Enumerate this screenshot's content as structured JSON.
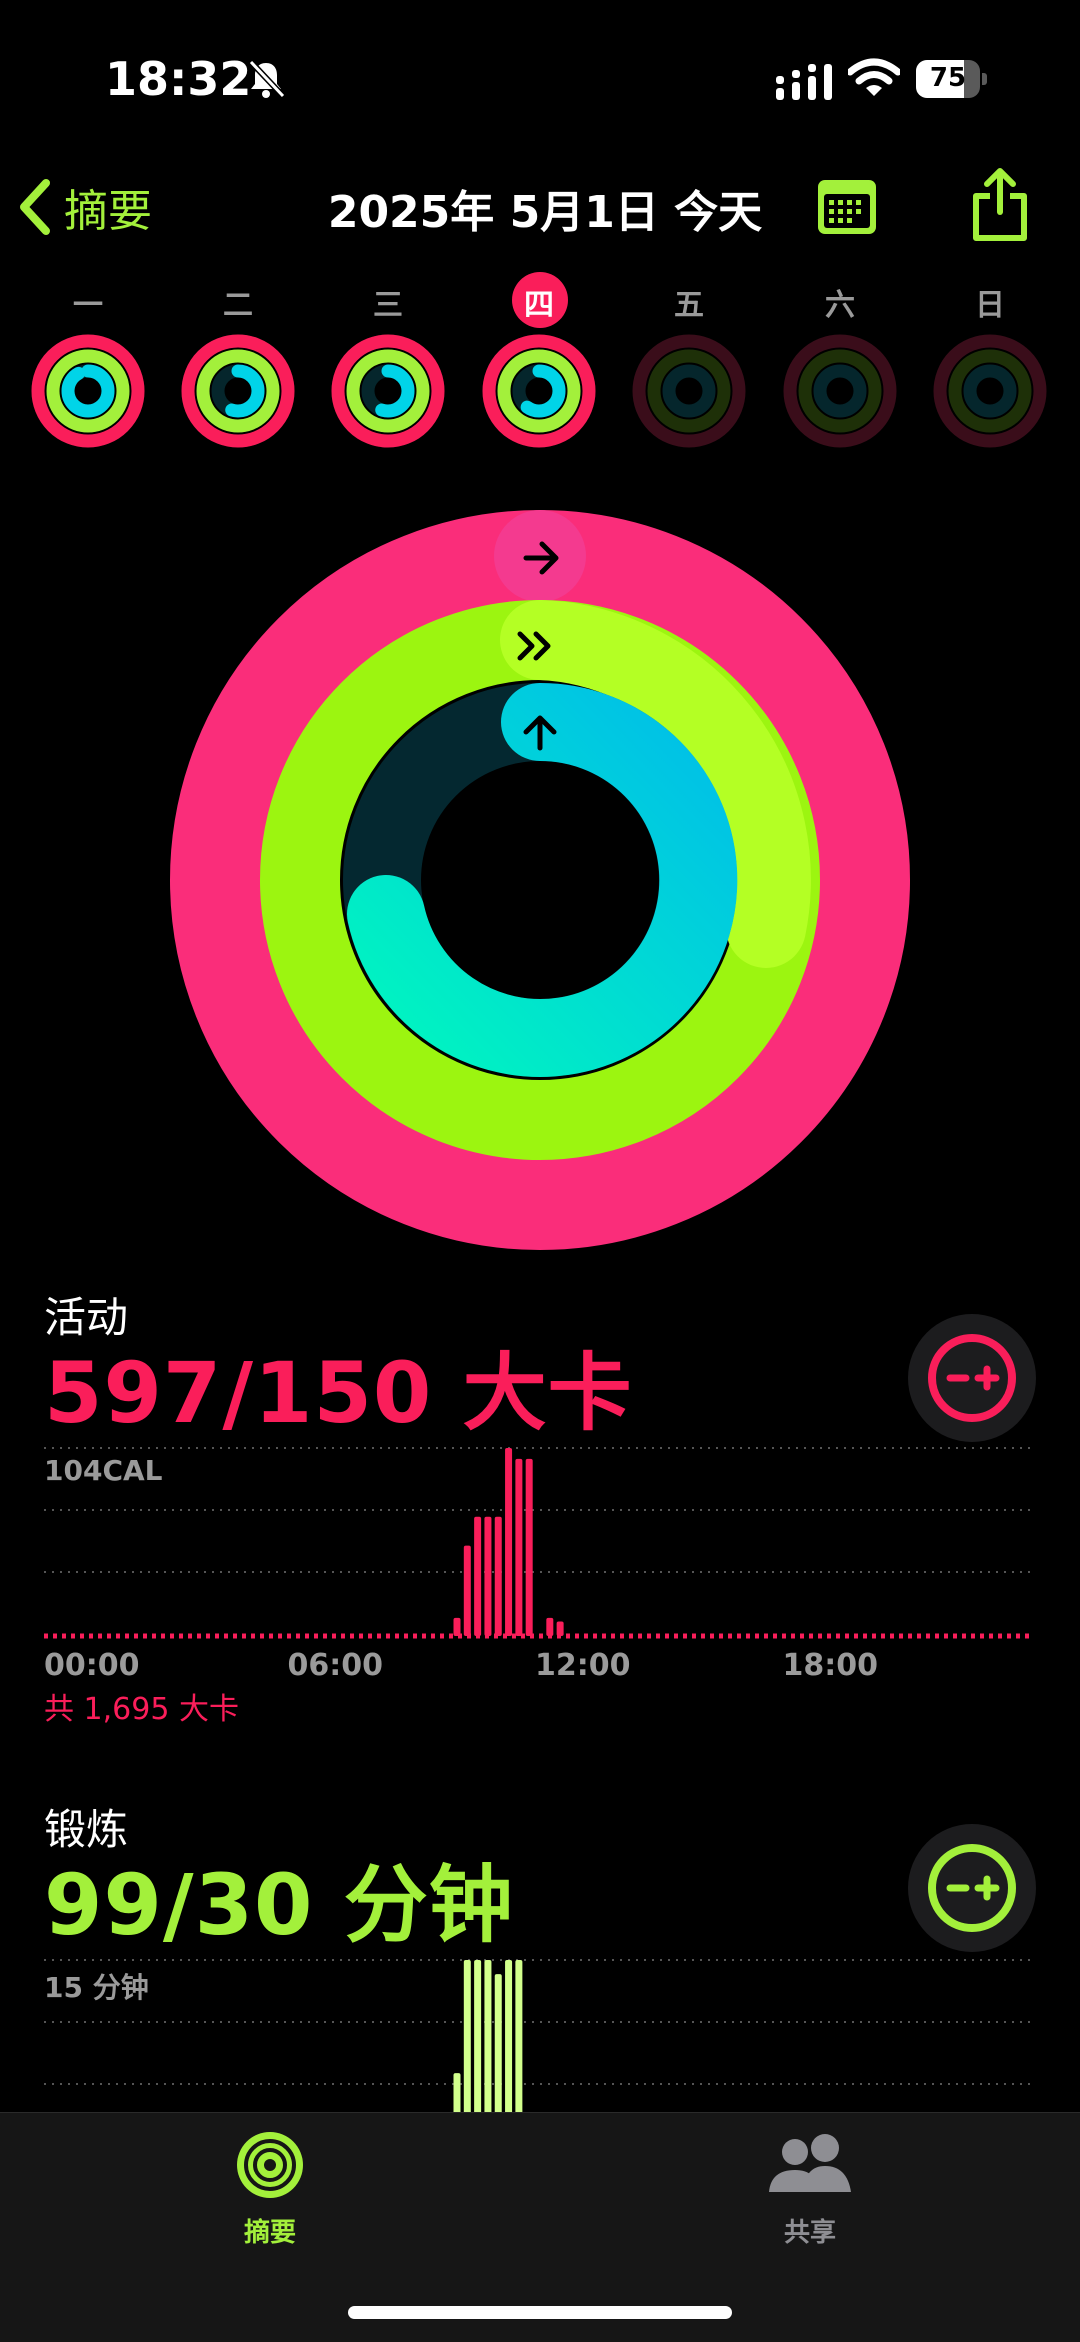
{
  "status": {
    "time": "18:32",
    "battery": "75",
    "battery_level": 0.75
  },
  "nav": {
    "back_label": "摘要",
    "title": "2025年 5月1日 今天"
  },
  "week": [
    {
      "label": "一",
      "move": 1.0,
      "exercise": 1.0,
      "stand": 0.92,
      "active": true
    },
    {
      "label": "二",
      "move": 1.0,
      "exercise": 1.0,
      "stand": 0.55,
      "active": true
    },
    {
      "label": "三",
      "move": 1.0,
      "exercise": 1.0,
      "stand": 0.55,
      "active": true
    },
    {
      "label": "四",
      "move": 1.0,
      "exercise": 1.0,
      "stand": 0.6,
      "active": true,
      "today": true
    },
    {
      "label": "五",
      "move": 0,
      "exercise": 0,
      "stand": 0,
      "active": false
    },
    {
      "label": "六",
      "move": 0,
      "exercise": 0,
      "stand": 0,
      "active": false
    },
    {
      "label": "日",
      "move": 0,
      "exercise": 0,
      "stand": 0,
      "active": false
    }
  ],
  "colors": {
    "move": "#fa1e5a",
    "exercise": "#a3f03b",
    "stand": "#00d4e8",
    "accent": "#a3f03b"
  },
  "activity": {
    "title": "活动",
    "value": "597/150 大卡",
    "chart_max_label": "104CAL",
    "total": "共 1,695 大卡"
  },
  "exercise": {
    "title": "锻炼",
    "value": "99/30 分钟",
    "chart_max_label": "15 分钟"
  },
  "chart_data": [
    {
      "type": "bar",
      "x_ticks": [
        "00:00",
        "06:00",
        "12:00",
        "18:00"
      ],
      "ylabel": "104CAL",
      "ylim": [
        0,
        104
      ],
      "x": [
        "10:00",
        "10:15",
        "10:30",
        "10:45",
        "11:00",
        "11:15",
        "11:30",
        "11:45",
        "12:15",
        "12:30"
      ],
      "values": [
        10,
        50,
        66,
        66,
        66,
        104,
        98,
        98,
        10,
        8
      ]
    },
    {
      "type": "bar",
      "ylabel": "15 分钟",
      "ylim": [
        0,
        15
      ],
      "x": [
        "10:00",
        "10:15",
        "10:30",
        "10:45",
        "11:00",
        "11:15",
        "11:30"
      ],
      "values": [
        7,
        15,
        15,
        15,
        14,
        15,
        15
      ]
    }
  ],
  "tabs": [
    {
      "label": "摘要",
      "active": true
    },
    {
      "label": "共享",
      "active": false
    }
  ]
}
